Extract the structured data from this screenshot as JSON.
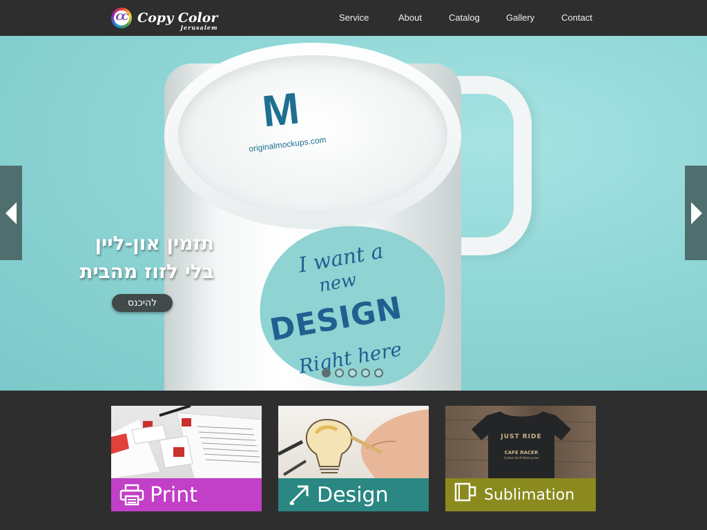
{
  "brand": {
    "logo_mark": "CC",
    "name": "Copy Color",
    "tagline": "Jerusalem"
  },
  "nav": {
    "items": [
      {
        "label": "Service"
      },
      {
        "label": "About"
      },
      {
        "label": "Catalog"
      },
      {
        "label": "Gallery"
      },
      {
        "label": "Contact"
      }
    ]
  },
  "hero": {
    "promo_line_1": "תזמין און-ליין",
    "promo_line_2": "בלי לזוז מהבית",
    "enter_button": "להיכנס",
    "mockup_brand": "M",
    "mockup_url": "originalmockups.com",
    "mug_text": {
      "line1": "I want a",
      "line2": "new",
      "line3": "DESIGN",
      "line4": "Right here"
    },
    "slides_count": 5,
    "active_slide": 1
  },
  "tiles": [
    {
      "label": "Print",
      "color": "#c23fc7",
      "icon": "printer-icon"
    },
    {
      "label": "Design",
      "color": "#2a8782",
      "icon": "pen-arrow-icon"
    },
    {
      "label": "Sublimation",
      "color": "#8a8a1e",
      "icon": "mug-icon"
    }
  ],
  "tshirt": {
    "line1": "JUST RIDE",
    "line2": "CAFE RACER",
    "line3": "Custom Built Motorcycles"
  },
  "colors": {
    "header_bg": "#2e2e2e",
    "hero_bg": "#8fd6d6",
    "arrow_bg": "#4f6f6e"
  }
}
